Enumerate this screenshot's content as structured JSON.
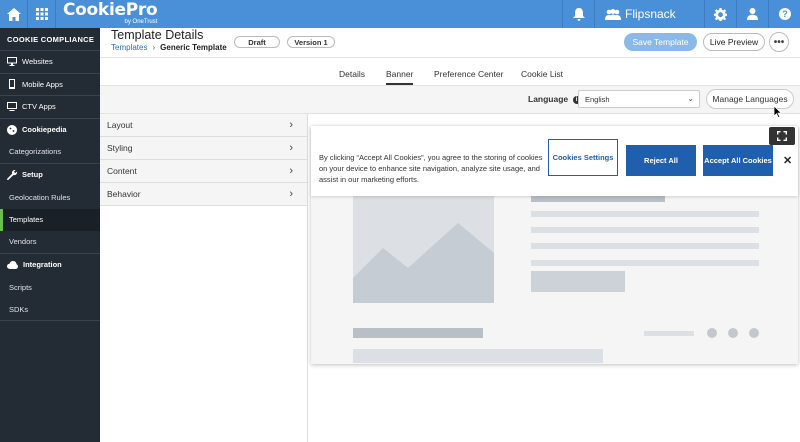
{
  "brand": {
    "name": "CookiePro",
    "sub": "by OneTrust"
  },
  "topbar": {
    "org_name": "Flipsnack",
    "icons": [
      "home-icon",
      "apps-grid-icon",
      "bell-icon",
      "organization-icon",
      "gear-icon",
      "user-icon",
      "help-icon"
    ]
  },
  "sidebar": {
    "heading": "COOKIE COMPLIANCE",
    "items": [
      {
        "label": "Websites",
        "icon": "monitor-icon"
      },
      {
        "label": "Mobile Apps",
        "icon": "mobile-icon"
      },
      {
        "label": "CTV Apps",
        "icon": "tv-icon"
      }
    ],
    "groups": [
      {
        "label": "Cookiepedia",
        "icon": "cookie-icon",
        "children": [
          "Categorizations"
        ]
      },
      {
        "label": "Setup",
        "icon": "wrench-icon",
        "children": [
          "Geolocation Rules",
          "Templates",
          "Vendors"
        ]
      },
      {
        "label": "Integration",
        "icon": "cloud-icon",
        "children": [
          "Scripts",
          "SDKs"
        ]
      }
    ],
    "active_item": "Templates"
  },
  "header": {
    "title": "Template Details",
    "breadcrumb": {
      "root": "Templates",
      "separator": "›",
      "current": "Generic Template"
    },
    "status_pill": "Draft",
    "version_pill": "Version 1",
    "save_label": "Save Template",
    "preview_label": "Live Preview",
    "more_label": "•••"
  },
  "tabs": [
    {
      "label": "Details"
    },
    {
      "label": "Banner",
      "active": true
    },
    {
      "label": "Preference Center"
    },
    {
      "label": "Cookie List"
    }
  ],
  "language": {
    "label": "Language",
    "selected": "English",
    "manage_label": "Manage Languages"
  },
  "left_panel": {
    "items": [
      "Layout",
      "Styling",
      "Content",
      "Behavior"
    ]
  },
  "banner": {
    "text": "By clicking “Accept All Cookies”, you agree to the storing of cookies on your device to enhance site navigation, analyze site usage, and assist in our marketing efforts.",
    "settings_label": "Cookies Settings",
    "reject_label": "Reject All",
    "accept_label": "Accept All Cookies",
    "close_label": "✕"
  },
  "colors": {
    "topbar": "#4a90d9",
    "sidebar": "#232b34",
    "active_accent": "#6cc04a",
    "banner_button": "#1f5fae"
  }
}
